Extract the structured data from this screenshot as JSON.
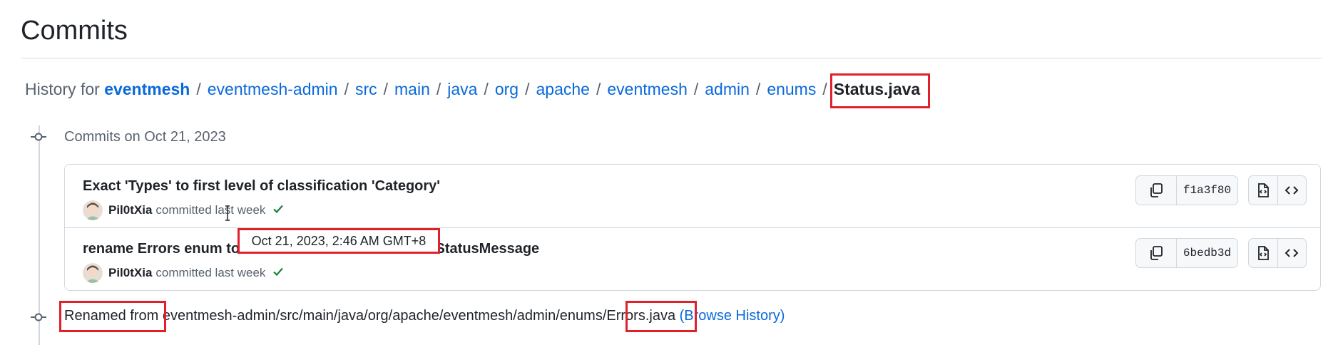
{
  "page": {
    "title": "Commits"
  },
  "breadcrumb": {
    "prefix": "History for",
    "root": "eventmesh",
    "segments": [
      "eventmesh-admin",
      "src",
      "main",
      "java",
      "org",
      "apache",
      "eventmesh",
      "admin",
      "enums"
    ],
    "current": "Status.java",
    "separator": "/"
  },
  "group": {
    "label": "Commits on Oct 21, 2023"
  },
  "commits": [
    {
      "message": "Exact 'Types' to first level of classification 'Category'",
      "author": "Pil0tXia",
      "action": "committed last week",
      "sha": "f1a3f80"
    },
    {
      "message": "rename Errors enum to Status and attribute desc to StatusMessage",
      "author": "Pil0tXia",
      "action": "committed last week",
      "sha": "6bedb3d"
    }
  ],
  "tooltip": {
    "text": "Oct 21, 2023, 2:46 AM GMT+8"
  },
  "rename": {
    "prefix": "Renamed from",
    "path": "eventmesh-admin/src/main/java/org/apache/eventmesh/admin/enums/",
    "file": "Errors.java",
    "link": "(Browse History)"
  },
  "colors": {
    "accent": "#0969da",
    "highlight": "#e0202a",
    "success": "#1a7f37"
  }
}
